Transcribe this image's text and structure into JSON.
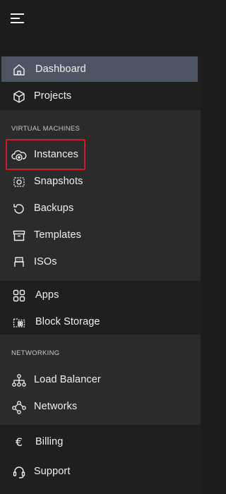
{
  "topbar": {
    "menu_icon": "hamburger-icon"
  },
  "nav": {
    "main": [
      {
        "key": "dashboard",
        "label": "Dashboard",
        "icon": "home-icon",
        "active": true
      },
      {
        "key": "projects",
        "label": "Projects",
        "icon": "cube-icon"
      }
    ],
    "virtual_machines": {
      "header": "VIRTUAL MACHINES",
      "items": [
        {
          "key": "instances",
          "label": "Instances",
          "icon": "cloud-plus-icon",
          "highlighted": true
        },
        {
          "key": "snapshots",
          "label": "Snapshots",
          "icon": "snapshot-icon"
        },
        {
          "key": "backups",
          "label": "Backups",
          "icon": "history-icon"
        },
        {
          "key": "templates",
          "label": "Templates",
          "icon": "archive-icon"
        },
        {
          "key": "isos",
          "label": "ISOs",
          "icon": "usb-icon"
        }
      ]
    },
    "apps_storage": [
      {
        "key": "apps",
        "label": "Apps",
        "icon": "grid-icon"
      },
      {
        "key": "block_storage",
        "label": "Block Storage",
        "icon": "storage-folder-icon"
      }
    ],
    "networking": {
      "header": "NETWORKING",
      "items": [
        {
          "key": "load_balancer",
          "label": "Load Balancer",
          "icon": "hierarchy-icon"
        },
        {
          "key": "networks",
          "label": "Networks",
          "icon": "network-icon"
        }
      ]
    },
    "account": [
      {
        "key": "billing",
        "label": "Billing",
        "icon": "euro-icon"
      },
      {
        "key": "support",
        "label": "Support",
        "icon": "headset-icon"
      }
    ]
  },
  "colors": {
    "background": "#1c1c1c",
    "section_dark": "#1f1f1f",
    "section_mid": "#2b2b2b",
    "active_item": "#4d5563",
    "highlight_border": "#d11a2a",
    "text": "#f0f0f0"
  }
}
